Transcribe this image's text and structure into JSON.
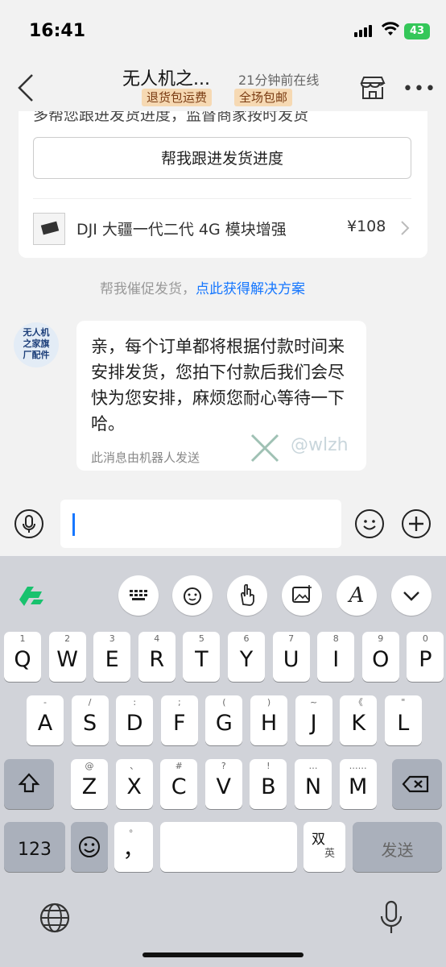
{
  "status_bar": {
    "time": "16:41",
    "battery": "43"
  },
  "header": {
    "title": "无人机之...",
    "online": "21分钟前在线",
    "tags": [
      "退货包运费",
      "全场包邮"
    ]
  },
  "card": {
    "truncated_text": "多帮您跟进发货进度，监督商家按时发货",
    "follow_button": "帮我跟进发货进度",
    "product_title": "DJI 大疆一代二代 4G 模块增强",
    "price": "¥108"
  },
  "hint": {
    "prefix": "帮我催促发货，",
    "link": "点此获得解决方案"
  },
  "avatar": {
    "line1": "无人机",
    "line2": "之家旗",
    "line3": "厂配件"
  },
  "message": {
    "text": "亲，每个订单都将根据付款时间来安排发货，您拍下付款后我们会尽快为您安排，麻烦您耐心等待一下哈。",
    "robot_note": "此消息由机器人发送",
    "watermark": "@wlzh"
  },
  "keyboard": {
    "row1": [
      {
        "k": "Q",
        "s": "1"
      },
      {
        "k": "W",
        "s": "2"
      },
      {
        "k": "E",
        "s": "3"
      },
      {
        "k": "R",
        "s": "4"
      },
      {
        "k": "T",
        "s": "5"
      },
      {
        "k": "Y",
        "s": "6"
      },
      {
        "k": "U",
        "s": "7"
      },
      {
        "k": "I",
        "s": "8"
      },
      {
        "k": "O",
        "s": "9"
      },
      {
        "k": "P",
        "s": "0"
      }
    ],
    "row2": [
      {
        "k": "A",
        "s": "-"
      },
      {
        "k": "S",
        "s": "/"
      },
      {
        "k": "D",
        "s": ":"
      },
      {
        "k": "F",
        "s": ";"
      },
      {
        "k": "G",
        "s": "("
      },
      {
        "k": "H",
        "s": ")"
      },
      {
        "k": "J",
        "s": "~"
      },
      {
        "k": "K",
        "s": "《"
      },
      {
        "k": "L",
        "s": "\""
      }
    ],
    "row3": [
      {
        "k": "Z",
        "s": "@"
      },
      {
        "k": "X",
        "s": "、"
      },
      {
        "k": "C",
        "s": "#"
      },
      {
        "k": "V",
        "s": "?"
      },
      {
        "k": "B",
        "s": "!"
      },
      {
        "k": "N",
        "s": "…"
      },
      {
        "k": "M",
        "s": "……"
      }
    ],
    "num_key": "123",
    "comma_key": "，",
    "comma_sub": "。",
    "lang_key_main": "双",
    "lang_key_sub": "英",
    "send_key": "发送"
  },
  "icons": {
    "back": "chevron-left-icon",
    "store": "store-icon",
    "more": "more-icon",
    "voice": "microphone-icon",
    "emoji": "emoji-icon",
    "plus": "plus-icon",
    "shift": "shift-icon",
    "delete": "backspace-icon",
    "globe": "globe-icon",
    "dictation": "microphone-icon"
  },
  "colors": {
    "accent": "#1677ff",
    "tag_bg": "#f6d9b3",
    "tag_text": "#7a3b12",
    "logo_green": "#18c26e"
  }
}
